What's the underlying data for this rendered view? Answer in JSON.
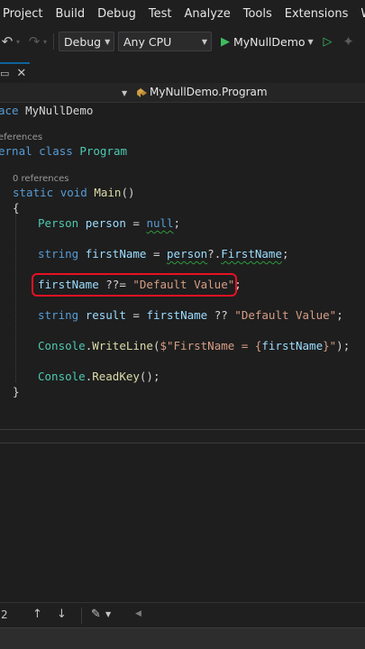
{
  "menu": [
    "Project",
    "Build",
    "Debug",
    "Test",
    "Analyze",
    "Tools",
    "Extensions",
    "Window"
  ],
  "toolbar": {
    "configuration": "Debug",
    "platform": "Any CPU",
    "run_target": "MyNullDemo"
  },
  "navbar": {
    "member": "MyNullDemo.Program"
  },
  "code": {
    "line_namespace_kw": "ace",
    "line_namespace_name": "MyNullDemo",
    "lens_class": "eferences",
    "line_class_kw": "ernal class",
    "line_class_name": "Program",
    "lens_main": "0 references",
    "main_static": "static",
    "main_void": "void",
    "main_name": "Main",
    "main_parens": "()",
    "open_brace": "{",
    "close_brace": "}",
    "person_type": "Person",
    "person_var": "person",
    "eq": "=",
    "null_kw": "null",
    "semi": ";",
    "string_kw": "string",
    "firstname_var": "firstName",
    "person_ref": "person",
    "cond_access": "?.",
    "firstname_prop": "FirstName",
    "coalesce_assign": "??=",
    "default_literal": "\"Default Value\"",
    "result_var": "result",
    "coalesce": "??",
    "console_type": "Console",
    "dot": ".",
    "writeline": "WriteLine",
    "paren_open": "(",
    "interp_string_a": "$\"FirstName = {",
    "interp_string_b": "}\"",
    "paren_close_semi": ");",
    "readkey": "ReadKey",
    "empty_parens_semi": "();"
  },
  "bottombar": {
    "line_number": "2"
  },
  "colors": {
    "highlight_border": "#e81123",
    "run_green": "#3dbd5e",
    "keyword_blue": "#569cd6",
    "type_teal": "#4ec9b0"
  }
}
